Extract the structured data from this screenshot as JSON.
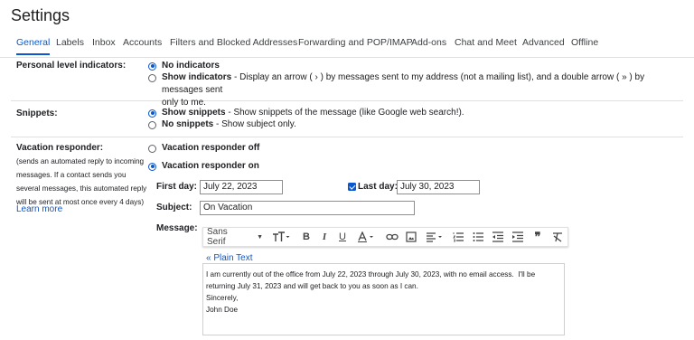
{
  "page": {
    "title": "Settings"
  },
  "tabs": [
    {
      "label": "General",
      "active": true
    },
    {
      "label": "Labels"
    },
    {
      "label": "Inbox"
    },
    {
      "label": "Accounts"
    },
    {
      "label": "Filters and Blocked Addresses"
    },
    {
      "label": "Forwarding and POP/IMAP"
    },
    {
      "label": "Add-ons"
    },
    {
      "label": "Chat and Meet"
    },
    {
      "label": "Advanced"
    },
    {
      "label": "Offline"
    }
  ],
  "personal_indicators": {
    "label": "Personal level indicators:",
    "options": [
      {
        "title": "No indicators",
        "desc": "",
        "selected": true
      },
      {
        "title": "Show indicators",
        "desc": " - Display an arrow ( › ) by messages sent to my address (not a mailing list), and a double arrow ( » ) by messages sent",
        "desc2": "only to me.",
        "selected": false
      }
    ]
  },
  "snippets": {
    "label": "Snippets:",
    "options": [
      {
        "title": "Show snippets",
        "desc": " - Show snippets of the message (like Google web search!).",
        "selected": true
      },
      {
        "title": "No snippets",
        "desc": " - Show subject only.",
        "selected": false
      }
    ]
  },
  "vacation": {
    "label": "Vacation responder:",
    "help_lines": [
      "(sends an automated reply to incoming",
      "messages. If a contact sends you",
      "several messages, this automated reply",
      "will be sent at most once every 4 days)"
    ],
    "learn_more": "Learn more",
    "off_label": "Vacation responder off",
    "on_label": "Vacation responder on",
    "on_selected": true,
    "first_day_label": "First day:",
    "first_day_value": "July 22, 2023",
    "last_day_label": "Last day:",
    "last_day_checked": true,
    "last_day_value": "July 30, 2023",
    "subject_label": "Subject:",
    "subject_value": "On Vacation",
    "message_label": "Message:",
    "plain_text_link": "« Plain Text",
    "font_select": "Sans Serif",
    "message_lines": [
      "I am currently out of the office from July 22, 2023 through July 30, 2023, with no email access.  I'll be",
      "returning July 31, 2023 and will get back to you as soon as I can.",
      "",
      "Sincerely,",
      "John Doe"
    ]
  },
  "colors": {
    "accent": "#0b57d0",
    "divider": "#e0e0e0",
    "text": "#202124"
  },
  "toolbar_icons": [
    "font-size-icon",
    "bold-icon",
    "italic-icon",
    "underline-icon",
    "text-color-icon",
    "link-icon",
    "image-icon",
    "align-icon",
    "numbered-list-icon",
    "bulleted-list-icon",
    "indent-less-icon",
    "indent-more-icon",
    "quote-icon",
    "remove-formatting-icon"
  ]
}
